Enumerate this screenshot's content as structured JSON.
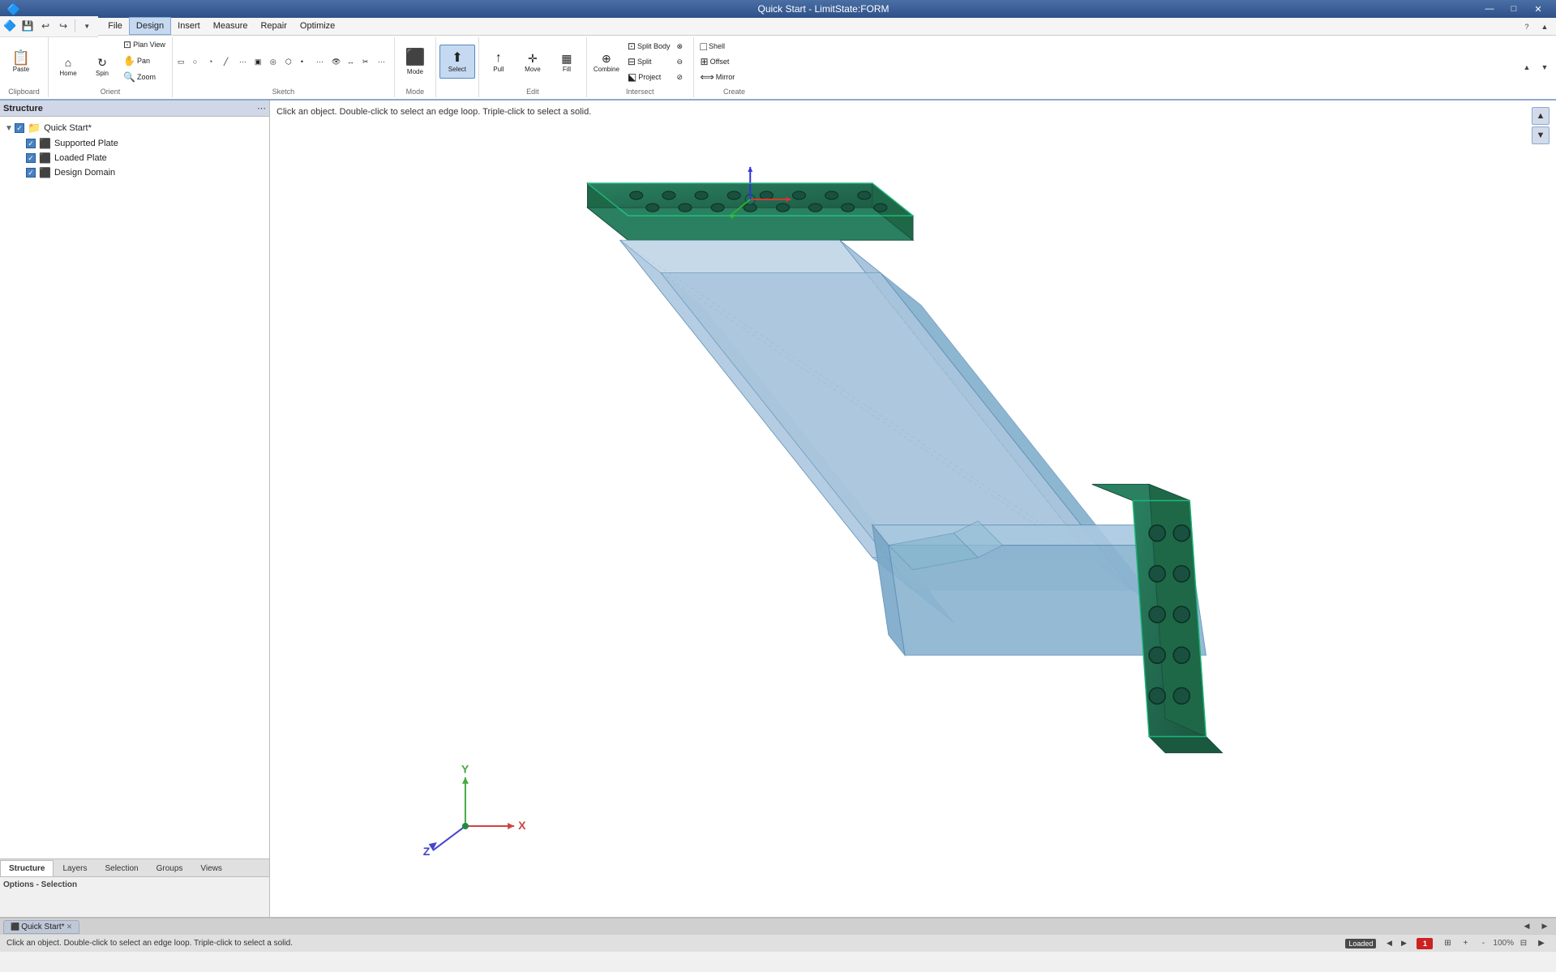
{
  "titleBar": {
    "title": "Quick Start - LimitState:FORM",
    "minimize": "—",
    "maximize": "□",
    "close": "✕"
  },
  "quickAccess": {
    "buttons": [
      "💾",
      "↩",
      "↪"
    ]
  },
  "menuBar": {
    "items": [
      "File",
      "Design",
      "Insert",
      "Measure",
      "Repair",
      "Optimize"
    ],
    "active": "Design"
  },
  "ribbonTabs": {
    "items": [],
    "active": ""
  },
  "ribbonGroups": {
    "clipboard": {
      "label": "Clipboard",
      "paste": "Paste"
    },
    "orient": {
      "label": "Orient",
      "home": "Home",
      "spin": "Spin",
      "planView": "Plan View",
      "pan": "Pan",
      "zoom": "Zoom"
    },
    "sketch": {
      "label": "Sketch"
    },
    "mode": {
      "label": "Mode"
    },
    "select": {
      "label": "",
      "select": "Select"
    },
    "edit": {
      "label": "Edit",
      "pull": "Pull",
      "move": "Move",
      "fill": "Fill"
    },
    "intersect": {
      "label": "Intersect",
      "combine": "Combine",
      "splitBody": "Split Body",
      "split": "Split",
      "project": "Project"
    },
    "create": {
      "label": "Create",
      "shell": "Shell",
      "offset": "Offset",
      "mirror": "Mirror"
    }
  },
  "viewportStatus": "Click an object. Double-click to select an edge loop. Triple-click to select a solid.",
  "structure": {
    "header": "Structure",
    "tree": [
      {
        "id": "quick-start",
        "label": "Quick Start*",
        "type": "root",
        "expanded": true,
        "checked": true,
        "indent": 0
      },
      {
        "id": "supported-plate",
        "label": "Supported Plate",
        "type": "object",
        "expanded": false,
        "checked": true,
        "indent": 1
      },
      {
        "id": "loaded-plate",
        "label": "Loaded Plate",
        "type": "object",
        "expanded": false,
        "checked": true,
        "indent": 1
      },
      {
        "id": "design-domain",
        "label": "Design Domain",
        "type": "object",
        "expanded": false,
        "checked": true,
        "indent": 1
      }
    ]
  },
  "sidebarTabs": {
    "items": [
      "Structure",
      "Layers",
      "Selection",
      "Groups",
      "Views"
    ],
    "active": "Structure"
  },
  "optionsPanel": {
    "title": "Options - Selection"
  },
  "bottomTabs": [
    {
      "label": "Quick Start*",
      "active": true
    }
  ],
  "statusBar": {
    "message": "Click an object. Double-click to select an edge loop. Triple-click to select a solid.",
    "loadedLabel": "Loaded",
    "indicator": "1"
  },
  "colors": {
    "accent": "#2d5088",
    "modelTeal": "#2a8060",
    "modelBlue": "#9abcd8",
    "modelDarkTeal": "#1a6050",
    "background": "#ffffff"
  }
}
